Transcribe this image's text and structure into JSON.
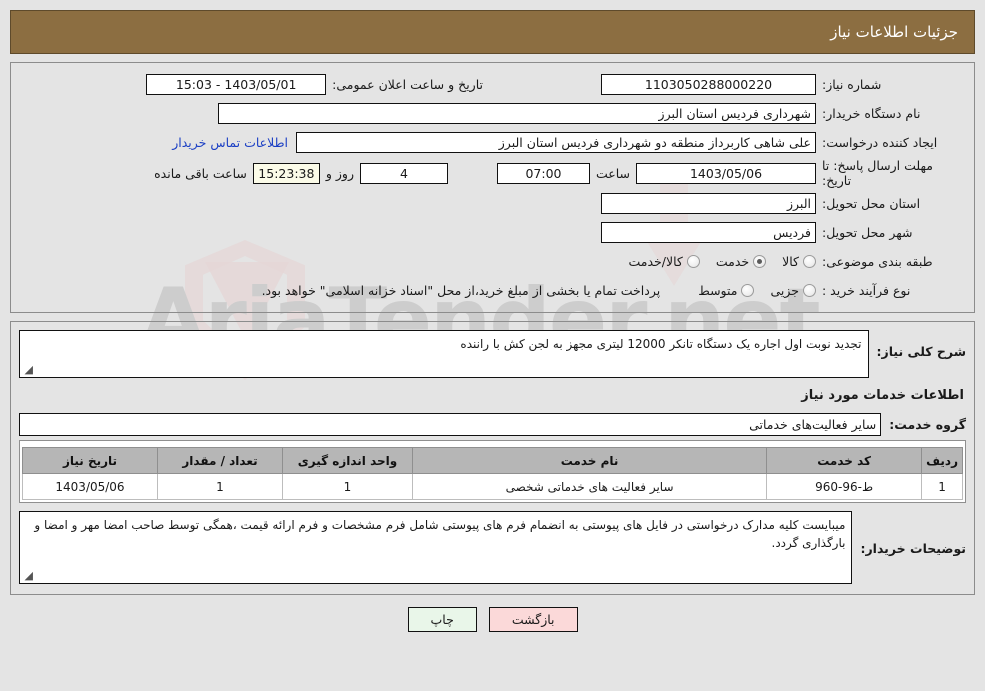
{
  "header": {
    "title": "جزئیات اطلاعات نیاز"
  },
  "form": {
    "need_number_label": "شماره نیاز:",
    "need_number_value": "1103050288000220",
    "announce_label": "تاریخ و ساعت اعلان عمومی:",
    "announce_value": "1403/05/01 - 15:03",
    "buyer_org_label": "نام دستگاه خریدار:",
    "buyer_org_value": "شهرداری فردیس استان البرز",
    "creator_label": "ایجاد کننده درخواست:",
    "creator_value": "علی شاهی کاربرداز منطقه دو شهرداری فردیس استان البرز",
    "contact_link": "اطلاعات تماس خریدار",
    "deadline_label": "مهلت ارسال پاسخ: تا تاریخ:",
    "deadline_date": "1403/05/06",
    "hour_label": "ساعت",
    "deadline_hour": "07:00",
    "days_value": "4",
    "days_label": "روز و",
    "countdown_value": "15:23:38",
    "countdown_label": "ساعت باقی مانده",
    "province_label": "استان محل تحویل:",
    "province_value": "البرز",
    "city_label": "شهر محل تحویل:",
    "city_value": "فردیس",
    "category_label": "طبقه بندی موضوعی:",
    "category_options": [
      {
        "label": "کالا",
        "selected": false
      },
      {
        "label": "خدمت",
        "selected": true
      },
      {
        "label": "کالا/خدمت",
        "selected": false
      }
    ],
    "process_label": "نوع فرآیند خرید :",
    "process_options": [
      {
        "label": "جزیی",
        "selected": false
      },
      {
        "label": "متوسط",
        "selected": false
      }
    ],
    "payment_note": "پرداخت تمام یا بخشی از مبلغ خرید،از محل \"اسناد خزانه اسلامی\" خواهد بود."
  },
  "need": {
    "summary_label": "شرح کلی نیاز:",
    "summary_value": "تجدید نوبت اول اجاره یک دستگاه تانکر 12000 لیتری مجهز به لجن کش با راننده",
    "services_head": "اطلاعات خدمات مورد نیاز",
    "service_group_label": "گروه خدمت:",
    "service_group_value": "سایر فعالیت‌های خدماتی"
  },
  "table": {
    "columns": [
      "ردیف",
      "کد خدمت",
      "نام خدمت",
      "واحد اندازه گیری",
      "تعداد / مقدار",
      "تاریخ نیاز"
    ],
    "rows": [
      {
        "index": "1",
        "code": "ط-96-960",
        "name": "سایر فعالیت های خدماتی شخصی",
        "unit": "1",
        "qty": "1",
        "date": "1403/05/06"
      }
    ]
  },
  "buyer_notes": {
    "label": "توضیحات خریدار:",
    "value": "میبایست کلیه مدارک درخواستی در فایل های پیوستی به انضمام فرم های پیوستی شامل فرم مشخصات و فرم ارائه قیمت ،همگی توسط صاحب امضا مهر و امضا و بارگذاری گردد."
  },
  "footer": {
    "print_label": "چاپ",
    "back_label": "بازگشت"
  },
  "watermark": {
    "text": "AriaTender.net"
  },
  "colors": {
    "header_bg": "#8c6e41",
    "link": "#1b3fc4",
    "print_btn": "#e9f6e9",
    "back_btn": "#fbd9d9",
    "countdown_bg": "#fbfbe8"
  }
}
